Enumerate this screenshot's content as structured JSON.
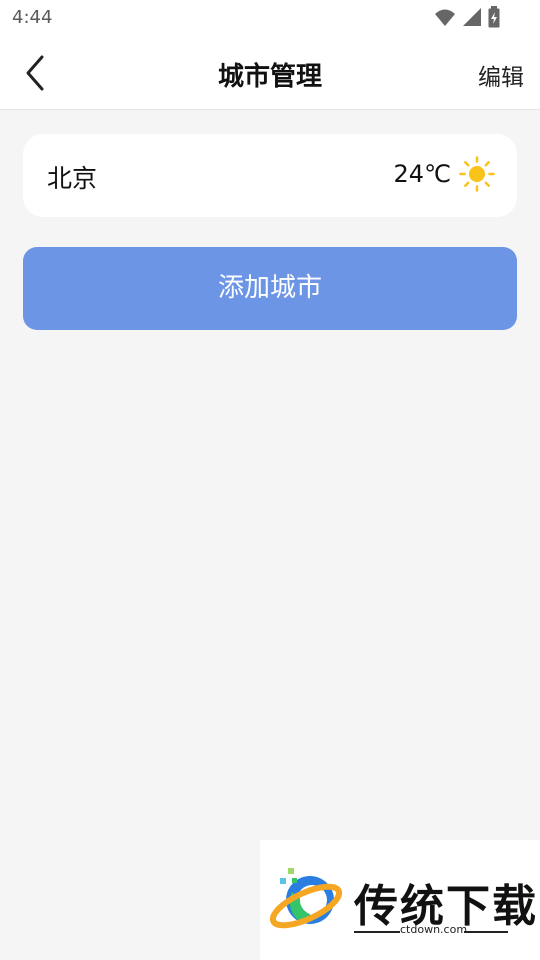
{
  "status_bar": {
    "time": "4:44"
  },
  "header": {
    "title": "城市管理",
    "edit_label": "编辑"
  },
  "city_list": [
    {
      "name": "北京",
      "temperature": "24℃",
      "weather_icon": "sun-icon"
    }
  ],
  "add_city_label": "添加城市",
  "watermark": {
    "title": "传统下载",
    "url": "ctdown.com"
  },
  "colors": {
    "accent": "#6c95e6",
    "sun": "#f9c31a",
    "background": "#f5f5f5"
  }
}
